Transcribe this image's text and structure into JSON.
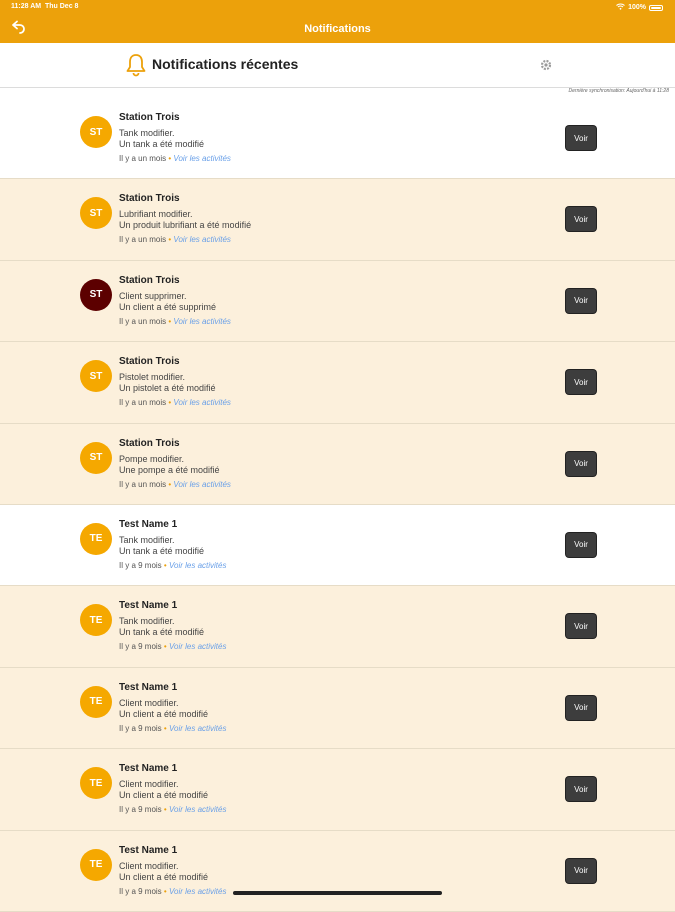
{
  "status_bar": {
    "time": "11:28 AM",
    "date": "Thu Dec 8",
    "battery": "100%"
  },
  "nav": {
    "title": "Notifications"
  },
  "header": {
    "title": "Notifications récentes",
    "sync_text": "Dernière synchronisation: Aujourd'hui à 11:28"
  },
  "colors": {
    "accent": "#ECA10B",
    "cream": "#FCF0DC",
    "dark_avatar": "#5C0000"
  },
  "notifications": [
    {
      "initials": "ST",
      "avatar_color": "#F5A800",
      "name": "Station Trois",
      "line1": "Tank modifier.",
      "line2": "Un tank a été modifié",
      "time": "Il y a un mois",
      "link": "Voir les activités",
      "button": "Voir",
      "bg": "white"
    },
    {
      "initials": "ST",
      "avatar_color": "#F5A800",
      "name": "Station Trois",
      "line1": "Lubrifiant modifier.",
      "line2": "Un produit lubrifiant a été modifié",
      "time": "Il y a un mois",
      "link": "Voir les activités",
      "button": "Voir",
      "bg": "cream"
    },
    {
      "initials": "ST",
      "avatar_color": "#5C0000",
      "name": "Station Trois",
      "line1": "Client supprimer.",
      "line2": "Un client a été supprimé",
      "time": "Il y a un mois",
      "link": "Voir les activités",
      "button": "Voir",
      "bg": "cream"
    },
    {
      "initials": "ST",
      "avatar_color": "#F5A800",
      "name": "Station Trois",
      "line1": "Pistolet modifier.",
      "line2": "Un pistolet a été modifié",
      "time": "Il y a un mois",
      "link": "Voir les activités",
      "button": "Voir",
      "bg": "cream"
    },
    {
      "initials": "ST",
      "avatar_color": "#F5A800",
      "name": "Station Trois",
      "line1": "Pompe modifier.",
      "line2": "Une pompe a été modifié",
      "time": "Il y a un mois",
      "link": "Voir les activités",
      "button": "Voir",
      "bg": "cream"
    },
    {
      "initials": "TE",
      "avatar_color": "#F5A800",
      "name": "Test Name 1",
      "line1": "Tank modifier.",
      "line2": "Un tank a été modifié",
      "time": "Il y a 9 mois",
      "link": "Voir les activités",
      "button": "Voir",
      "bg": "white"
    },
    {
      "initials": "TE",
      "avatar_color": "#F5A800",
      "name": "Test Name 1",
      "line1": "Tank modifier.",
      "line2": "Un tank a été modifié",
      "time": "Il y a 9 mois",
      "link": "Voir les activités",
      "button": "Voir",
      "bg": "cream"
    },
    {
      "initials": "TE",
      "avatar_color": "#F5A800",
      "name": "Test Name 1",
      "line1": "Client modifier.",
      "line2": "Un client a été modifié",
      "time": "Il y a 9 mois",
      "link": "Voir les activités",
      "button": "Voir",
      "bg": "cream"
    },
    {
      "initials": "TE",
      "avatar_color": "#F5A800",
      "name": "Test Name 1",
      "line1": "Client modifier.",
      "line2": "Un client a été modifié",
      "time": "Il y a 9 mois",
      "link": "Voir les activités",
      "button": "Voir",
      "bg": "cream"
    },
    {
      "initials": "TE",
      "avatar_color": "#F5A800",
      "name": "Test Name 1",
      "line1": "Client modifier.",
      "line2": "Un client a été modifié",
      "time": "Il y a 9 mois",
      "link": "Voir les activités",
      "button": "Voir",
      "bg": "cream"
    }
  ]
}
